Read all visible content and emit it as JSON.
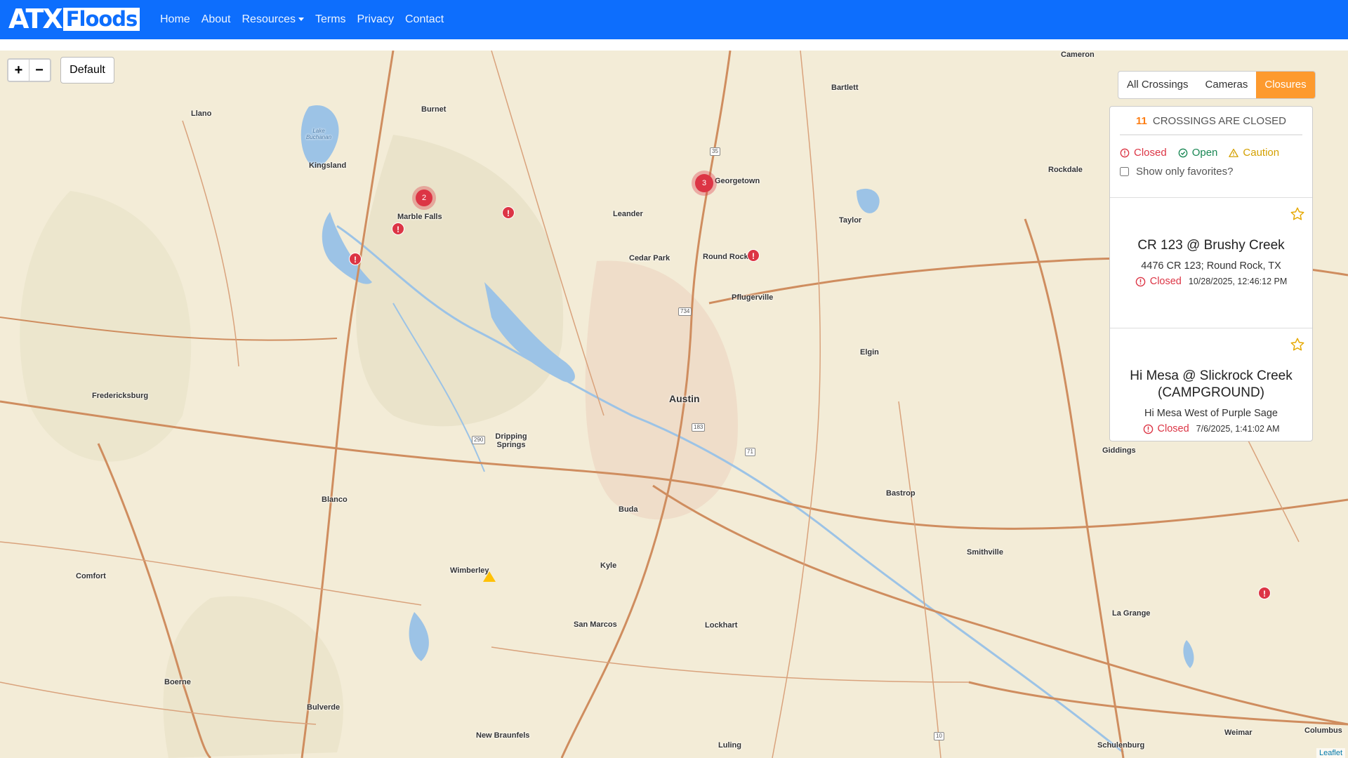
{
  "navbar": {
    "brand_atx": "ATX",
    "brand_floods": "Floods",
    "links": [
      "Home",
      "About",
      "Resources",
      "Terms",
      "Privacy",
      "Contact"
    ]
  },
  "map": {
    "zoom_in": "+",
    "zoom_out": "−",
    "default_label": "Default",
    "towns": [
      "Llano",
      "Burnet",
      "Kingsland",
      "Marble Falls",
      "Bartlett",
      "Cameron",
      "Georgetown",
      "Leander",
      "Taylor",
      "Rockdale",
      "Cedar Park",
      "Round Rock",
      "Pflugerville",
      "Elgin",
      "Fredericksburg",
      "Austin",
      "Dripping Springs",
      "Giddings",
      "Blanco",
      "Buda",
      "Bastrop",
      "Smithville",
      "Comfort",
      "Wimberley",
      "Kyle",
      "San Marcos",
      "Lockhart",
      "La Grange",
      "Boerne",
      "Bulverde",
      "New Braunfels",
      "Luling",
      "Schulenburg",
      "Weimar",
      "Columbus",
      "Lake Buchanan"
    ],
    "clusters": [
      "2",
      "3"
    ],
    "attribution": "Leaflet"
  },
  "filters": {
    "tabs": [
      "All Crossings",
      "Cameras",
      "Closures"
    ],
    "active": "Closures"
  },
  "panel": {
    "count": "11",
    "count_text": "CROSSINGS ARE CLOSED",
    "legend": {
      "closed": "Closed",
      "open": "Open",
      "caution": "Caution"
    },
    "favorites_label": "Show only favorites?",
    "crossings": [
      {
        "title": "CR 123 @ Brushy Creek",
        "address": "4476 CR 123; Round Rock, TX",
        "status": "Closed",
        "time": "10/28/2025, 12:46:12 PM"
      },
      {
        "title": "Hi Mesa @ Slickrock Creek (CAMPGROUND)",
        "address": "Hi Mesa West of Purple Sage",
        "status": "Closed",
        "time": "7/6/2025, 1:41:02 AM"
      }
    ]
  },
  "colors": {
    "navbar": "#0d6efd",
    "closed": "#dc3545",
    "open": "#198754",
    "caution": "#d4a000",
    "active_tab": "#fd9a2e"
  }
}
